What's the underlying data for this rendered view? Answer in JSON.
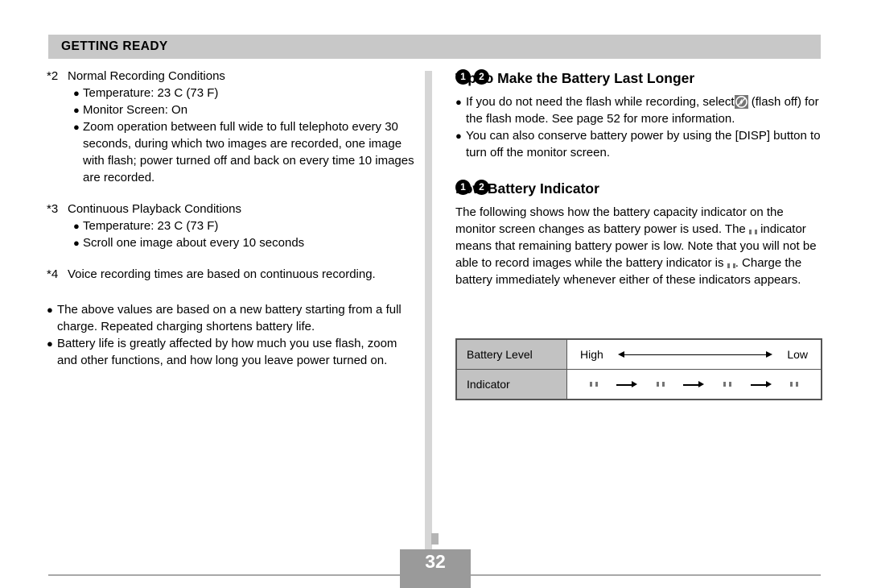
{
  "header": {
    "title": "GETTING READY"
  },
  "left_column": {
    "notes": [
      {
        "marker": "*2",
        "heading": "Normal Recording Conditions",
        "items": [
          "Temperature: 23 C (73 F)",
          "Monitor Screen: On",
          "Zoom operation between full wide to full telephoto every 30 seconds, during which two images are recorded, one image with flash; power turned off and back on every time 10 images are recorded."
        ]
      },
      {
        "marker": "*3",
        "heading": "Continuous Playback Conditions",
        "items": [
          "Temperature: 23 C (73 F)",
          "Scroll one image about every 10 seconds"
        ]
      },
      {
        "marker": "*4",
        "heading": "Voice recording times are based on continuous recording.",
        "items": []
      }
    ],
    "bullets": [
      "The above values are based on a new battery starting from a full charge. Repeated charging shortens battery life.",
      "Battery life is greatly affected by how much you use flash, zoom and other functions, and how long you leave power turned on."
    ]
  },
  "right_column": {
    "section1": {
      "badge1": "1",
      "badge2": "2",
      "heading": "Tip to Make the Battery Last Longer",
      "bullets": [
        {
          "part1": "If you do not need the flash while recording, select",
          "icon": "flash-off-icon",
          "part2": "(flash off) for the flash mode. See page 52 for more information."
        },
        {
          "part1": "You can also conserve battery power by using the [DISP] button to turn off the monitor screen.",
          "icon": "",
          "part2": ""
        }
      ]
    },
    "section2": {
      "badge1": "1",
      "badge2": "2",
      "heading": "Low Battery Indicator",
      "paragraph": {
        "seg1": "The following shows how the battery capacity indicator on the monitor screen changes as battery power is used. The",
        "icon1": "battery-low-icon",
        "seg2": "indicator means that remaining battery power is low. Note that you will not be able to record images while the battery indicator is",
        "icon2": "battery-empty-icon",
        "seg3": ". Charge the battery immediately whenever either of these indicators appears."
      }
    },
    "table": {
      "row_labels": [
        "Battery Level",
        "Indicator"
      ],
      "level_high": "High",
      "level_low": "Low",
      "indicator_fills": [
        0,
        35,
        65,
        100
      ],
      "arrow_count": 3
    }
  },
  "footer": {
    "page_number": "32"
  },
  "colors": {
    "header_band": "#c8c8c8",
    "divider": "#d6d6d6",
    "table_label_bg": "#c2c2c2",
    "icon_bg": "#757575",
    "page_box_bg": "#9a9a9a",
    "rule": "#a8a8a8"
  }
}
